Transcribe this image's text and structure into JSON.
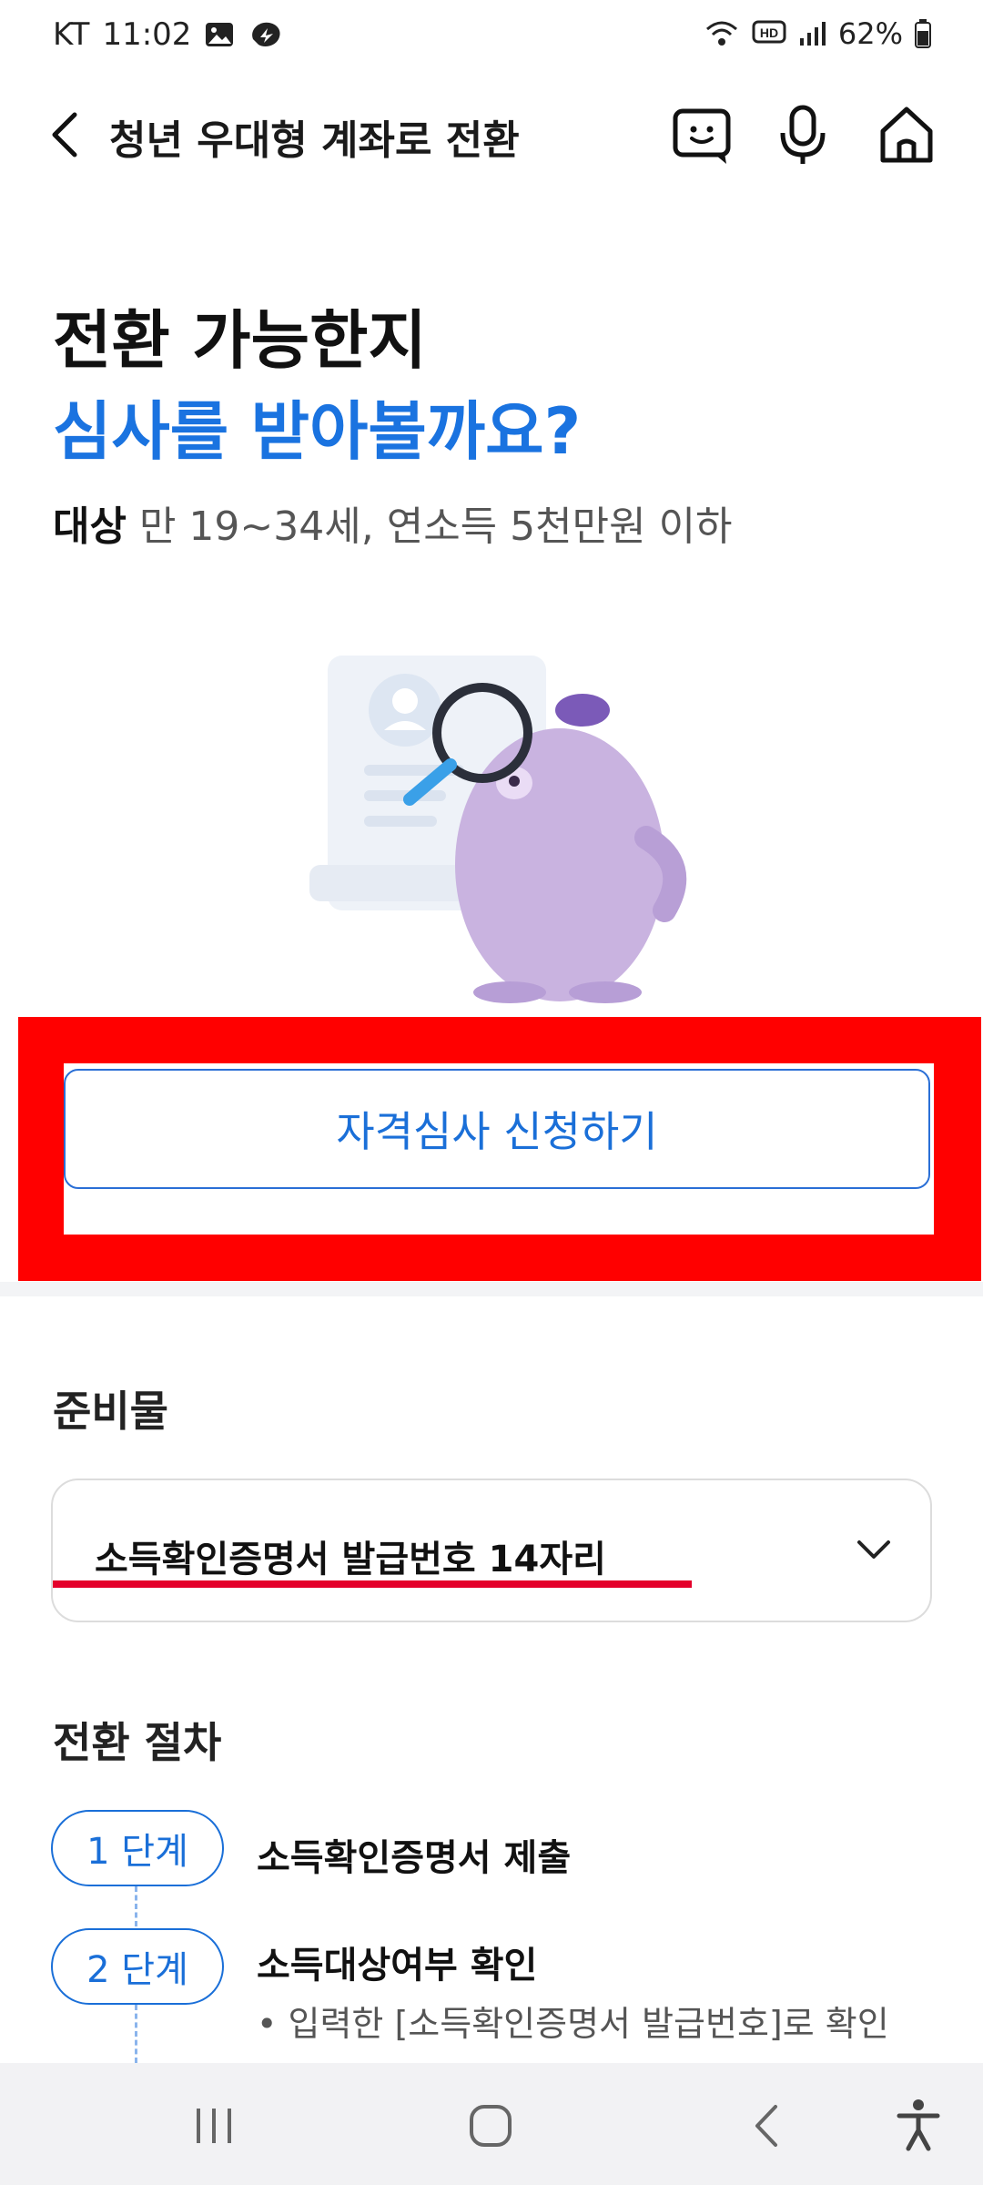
{
  "status": {
    "carrier": "KT",
    "time": "11:02",
    "battery": "62%"
  },
  "header": {
    "title": "청년 우대형 계좌로 전환",
    "back_icon": "chevron-left-icon",
    "icons": [
      "chat-icon",
      "microphone-icon",
      "home-icon"
    ]
  },
  "hero": {
    "line1": "전환 가능한지",
    "line2": "심사를 받아볼까요?",
    "target_label": "대상",
    "target_text": " 만 19~34세, 연소득 5천만원 이하"
  },
  "apply_button": "자격심사 신청하기",
  "prep": {
    "title": "준비물",
    "item": "소득확인증명서 발급번호 14자리"
  },
  "procedure": {
    "title": "전환 절차",
    "steps": [
      {
        "badge": "1 단계",
        "label": "소득확인증명서 제출"
      },
      {
        "badge": "2 단계",
        "label": "소득대상여부 확인",
        "note": "입력한 [소득확인증명서 발급번호]로 확인"
      }
    ]
  },
  "colors": {
    "accent": "#1a73e0",
    "highlight": "#ff0000"
  }
}
